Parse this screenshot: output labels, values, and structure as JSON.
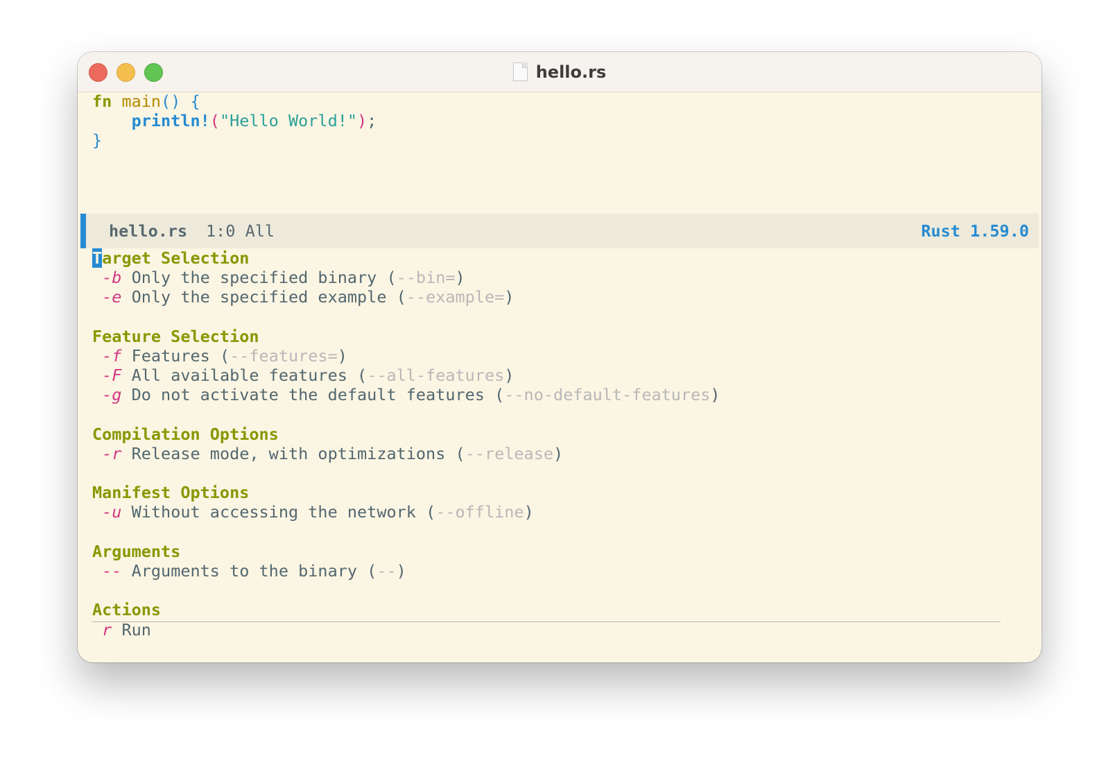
{
  "window": {
    "title": "hello.rs",
    "icons": {
      "file": "document-icon"
    }
  },
  "code": {
    "line1_kw": "fn",
    "line1_name": "main",
    "line1_parens": "()",
    "line1_brace": "{",
    "line2_macro": "println!",
    "line2_open": "(",
    "line2_string": "\"Hello World!\"",
    "line2_close": ")",
    "line2_semi": ";",
    "line3_brace": "}"
  },
  "modeline": {
    "buffer": "hello.rs",
    "position": "1:0 All",
    "mode": "Rust 1.59.0"
  },
  "menu": {
    "sections": [
      {
        "heading_first": "T",
        "heading_rest": "arget Selection",
        "items": [
          {
            "key": "-b",
            "desc": "Only the specified binary",
            "flag": "--bin="
          },
          {
            "key": "-e",
            "desc": "Only the specified example",
            "flag": "--example="
          }
        ]
      },
      {
        "heading": "Feature Selection",
        "items": [
          {
            "key": "-f",
            "desc": "Features",
            "flag": "--features="
          },
          {
            "key": "-F",
            "desc": "All available features",
            "flag": "--all-features"
          },
          {
            "key": "-g",
            "desc": "Do not activate the default features",
            "flag": "--no-default-features"
          }
        ]
      },
      {
        "heading": "Compilation Options",
        "items": [
          {
            "key": "-r",
            "desc": "Release mode, with optimizations",
            "flag": "--release"
          }
        ]
      },
      {
        "heading": "Manifest Options",
        "items": [
          {
            "key": "-u",
            "desc": "Without accessing the network",
            "flag": "--offline"
          }
        ]
      },
      {
        "heading": "Arguments",
        "items": [
          {
            "key": "--",
            "desc": "Arguments to the binary",
            "flag": "--"
          }
        ]
      },
      {
        "heading": "Actions",
        "items": [
          {
            "key": "r",
            "desc": "Run"
          }
        ]
      }
    ]
  },
  "colors": {
    "background": "#fbf5e3",
    "heading": "#859900",
    "key": "#d33682",
    "accent": "#268bd2",
    "string": "#2aa198",
    "function": "#b58900",
    "flag": "#b8b8b8"
  }
}
